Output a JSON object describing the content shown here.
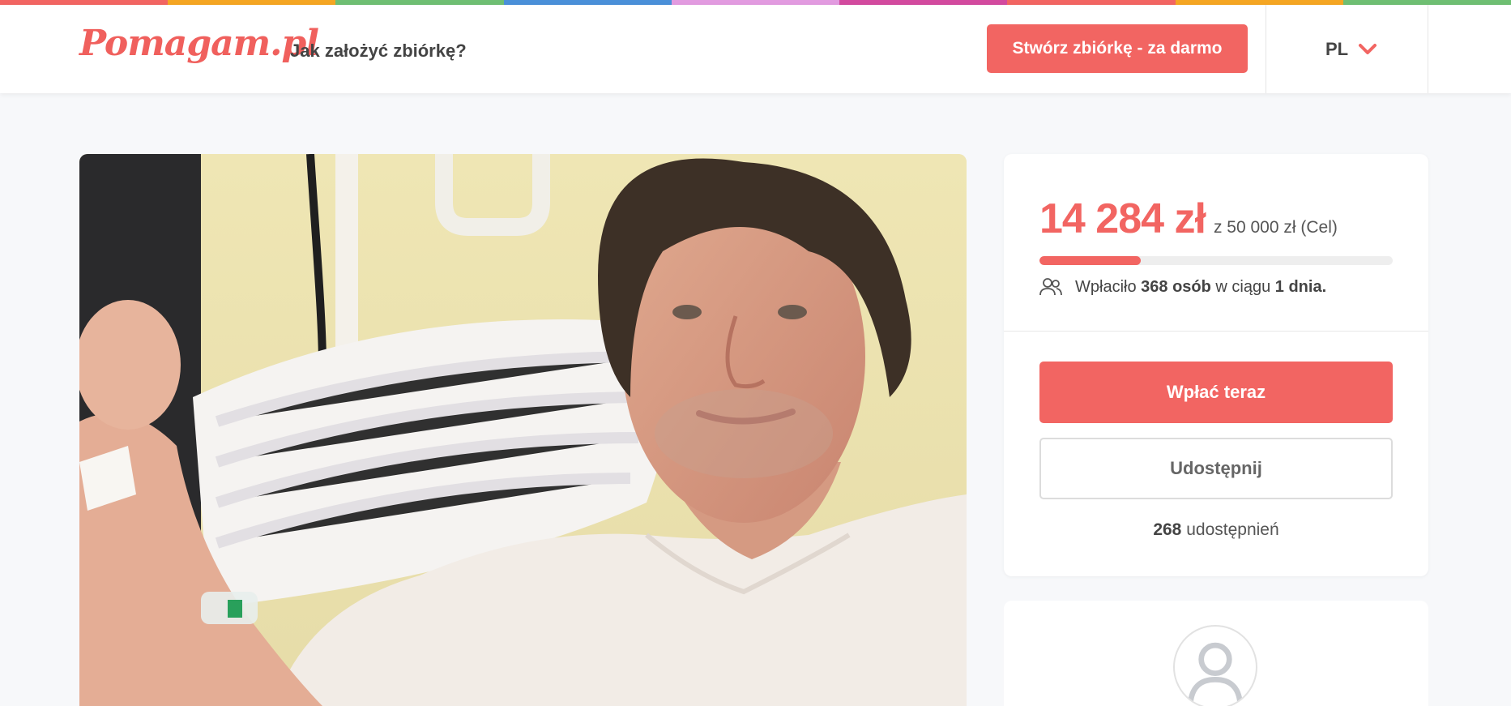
{
  "colors": {
    "brand": "#f26562",
    "rainbow": [
      "#f26562",
      "#f5a623",
      "#6fbf73",
      "#4a90d9",
      "#e29be0",
      "#d34a9f",
      "#f26562",
      "#f5a623",
      "#6fbf73"
    ]
  },
  "header": {
    "logo": "Pomagam.pl",
    "how_to": "Jak założyć zbiórkę?",
    "create_button": "Stwórz zbiórkę - za darmo",
    "language": "PL",
    "language_icon": "chevron-down-icon"
  },
  "hero": {
    "image_subject": "man-in-hospital-bed-photo"
  },
  "donation": {
    "amount": "14 284 zł",
    "goal": "z 50 000 zł (Cel)",
    "progress_fraction": 0.2857,
    "donors_prefix": "Wpłaciło",
    "donors_count": "368 osób",
    "donors_middle": "w ciągu",
    "donors_time": "1 dnia.",
    "donors_icon": "people-icon",
    "pay_button": "Wpłać teraz",
    "share_button": "Udostępnij",
    "shares_count": "268",
    "shares_label": "udostępnień"
  },
  "organizer": {
    "avatar_icon": "user-avatar-icon"
  }
}
